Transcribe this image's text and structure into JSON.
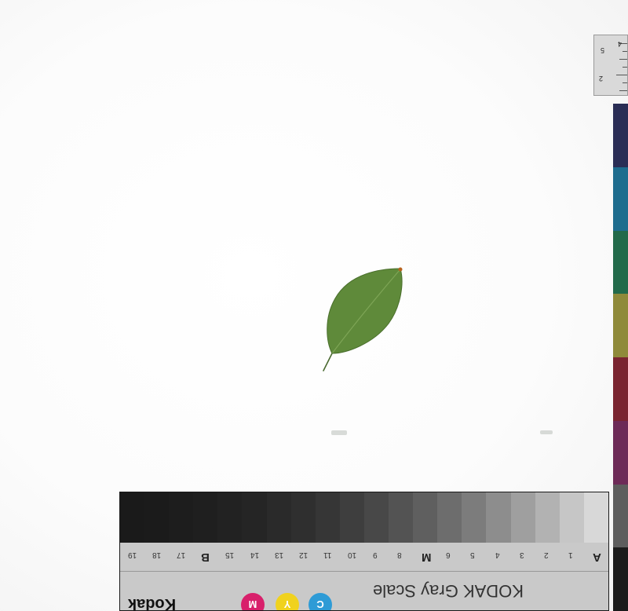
{
  "ruler": {
    "numbers": [
      "2",
      "4",
      "5"
    ]
  },
  "color_strip": {
    "patches": [
      "#2a2d55",
      "#1e6c8e",
      "#226a4a",
      "#8f8a3a",
      "#7a2430",
      "#6d2a57",
      "#5d5d5d",
      "#1b1b1b"
    ]
  },
  "leaf": {
    "fill": "#5f8a3a",
    "vein": "#7ea556",
    "tip": "#b8621d"
  },
  "gray_scale": {
    "title": "KODAK Gray Scale",
    "brand": "Kodak",
    "brand_note": "",
    "steps": [
      "#d8d8d8",
      "#c6c6c6",
      "#b2b2b2",
      "#9f9f9f",
      "#8d8d8d",
      "#7c7c7c",
      "#6d6d6d",
      "#5f5f5f",
      "#535353",
      "#484848",
      "#3e3e3e",
      "#363636",
      "#2f2f2f",
      "#2a2a2a",
      "#252525",
      "#222222",
      "#1f1f1f",
      "#1d1d1d",
      "#1b1b1b",
      "#1a1a1a"
    ],
    "labels": [
      "A",
      "1",
      "2",
      "3",
      "4",
      "5",
      "6",
      "M",
      "8",
      "9",
      "10",
      "11",
      "12",
      "13",
      "14",
      "15",
      "B",
      "17",
      "18",
      "19"
    ],
    "cmy": [
      {
        "letter": "C",
        "color": "#2e9bd6"
      },
      {
        "letter": "Y",
        "color": "#f0d21e"
      },
      {
        "letter": "M",
        "color": "#d8206b"
      }
    ]
  }
}
